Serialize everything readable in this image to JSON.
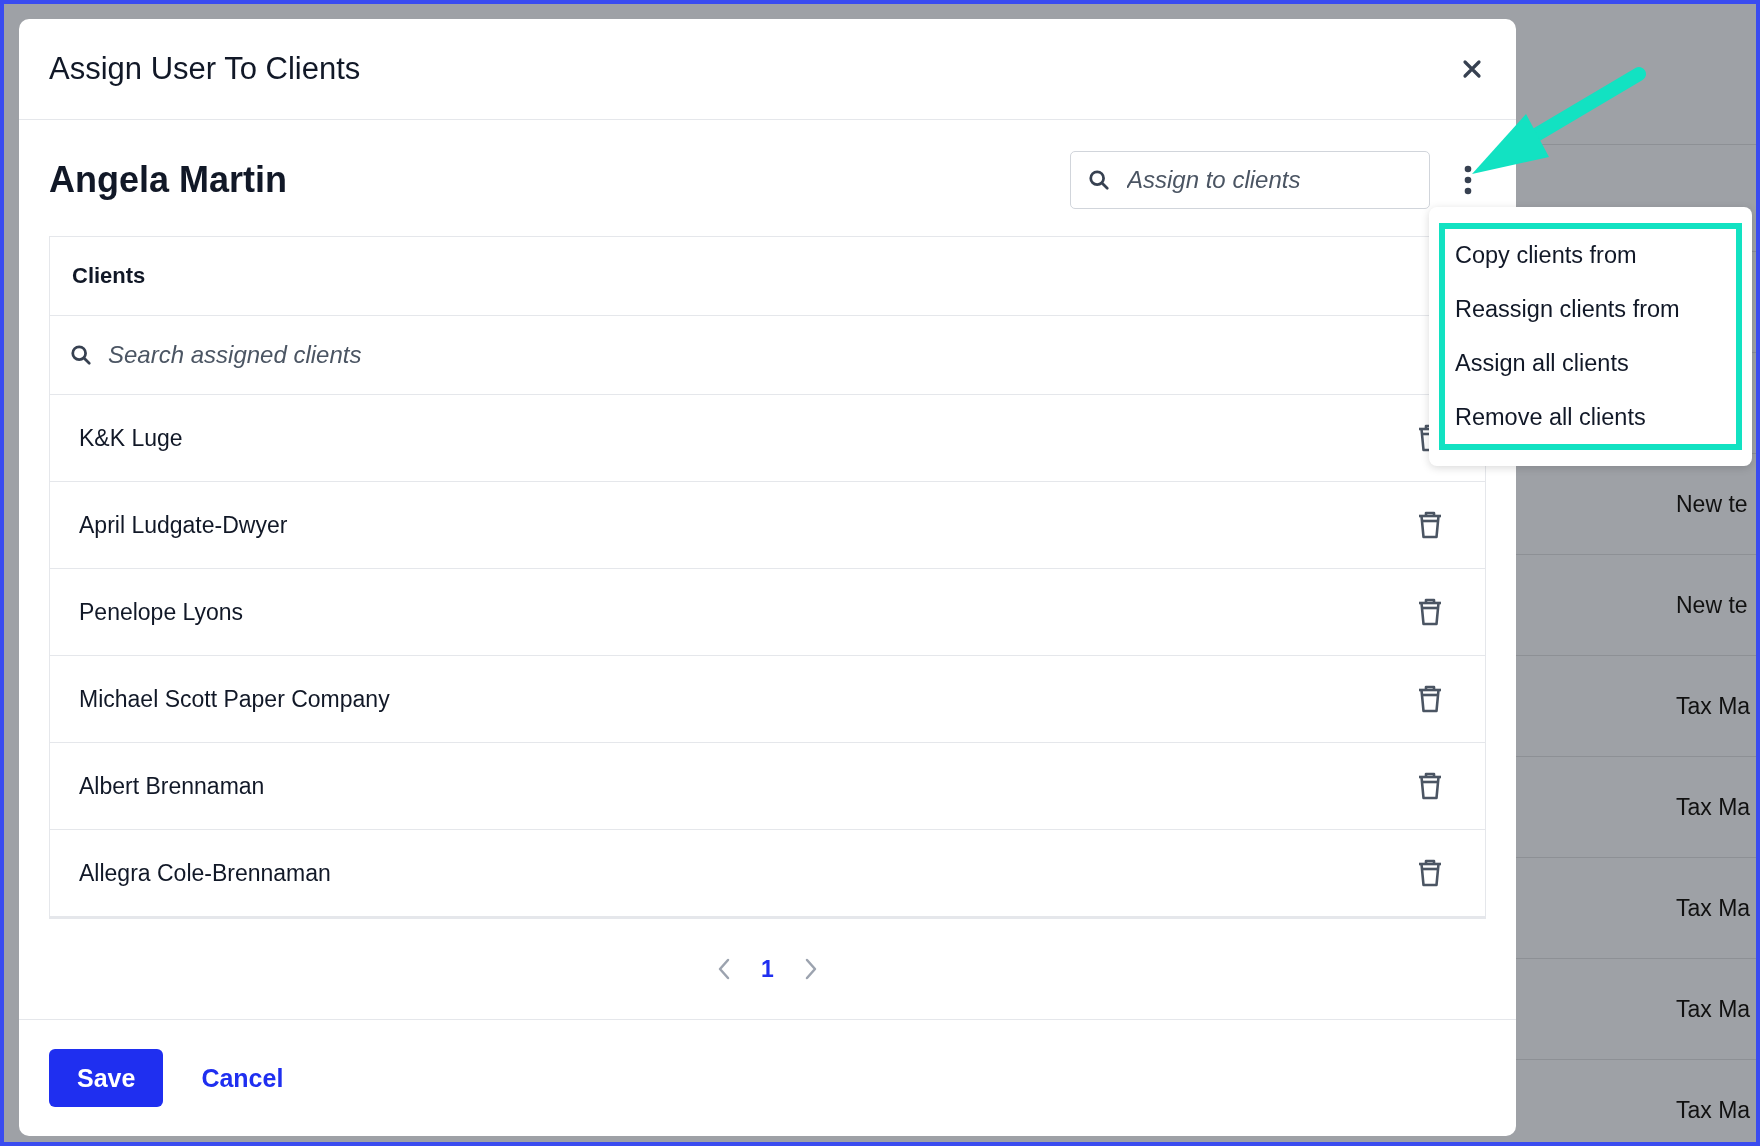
{
  "background_table": {
    "rows": [
      {
        "column_1": "New te"
      },
      {
        "column_1": "New te"
      },
      {
        "column_1": "Tax Ma"
      },
      {
        "column_1": "Tax Ma"
      },
      {
        "column_1": "Tax Ma"
      },
      {
        "column_1": "Tax Ma"
      },
      {
        "column_1": "Tax Ma"
      }
    ]
  },
  "dialog": {
    "title": "Assign User To Clients",
    "user_name": "Angela Martin",
    "assign_search": {
      "placeholder": "Assign to clients"
    },
    "table": {
      "header": "Clients",
      "search": {
        "placeholder": "Search assigned clients"
      },
      "rows": [
        {
          "name": "K&K Luge"
        },
        {
          "name": "April Ludgate-Dwyer"
        },
        {
          "name": "Penelope Lyons"
        },
        {
          "name": "Michael Scott Paper Company"
        },
        {
          "name": "Albert Brennaman"
        },
        {
          "name": "Allegra Cole-Brennaman"
        }
      ]
    },
    "pagination": {
      "pages": [
        {
          "label": "1",
          "selected": true
        }
      ]
    },
    "buttons": [
      {
        "label": "Save",
        "kind": "primary"
      },
      {
        "label": "Cancel",
        "kind": "link"
      }
    ]
  },
  "menu": {
    "items": [
      {
        "label": "Copy clients from"
      },
      {
        "label": "Reassign clients from"
      },
      {
        "label": "Assign all clients"
      },
      {
        "label": "Remove all clients"
      }
    ]
  }
}
